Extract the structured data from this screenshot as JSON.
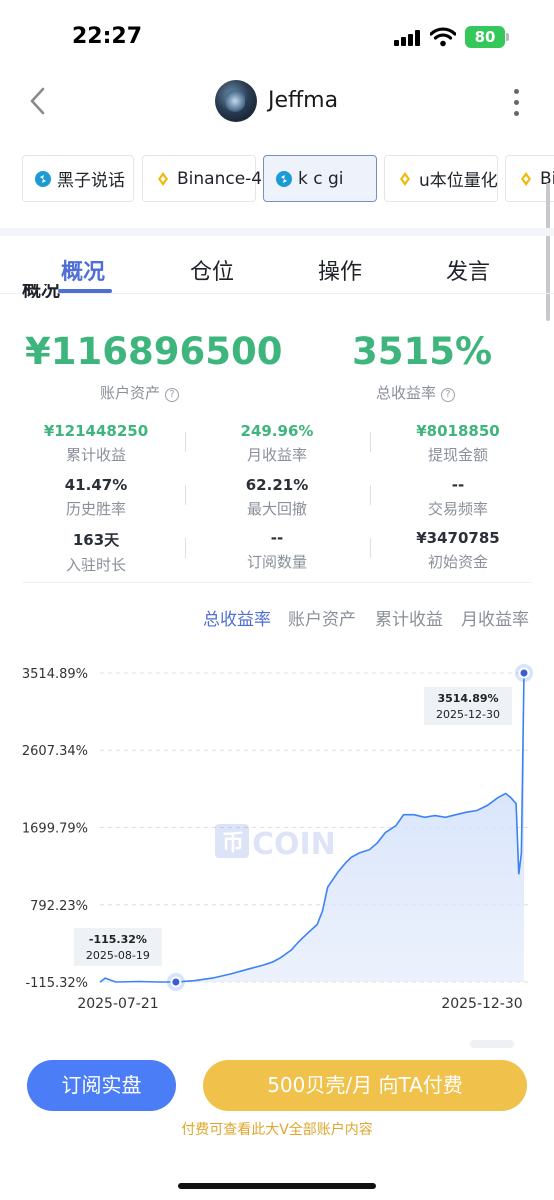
{
  "status_bar": {
    "time": "22:27",
    "battery": "80"
  },
  "header": {
    "username": "Jeffma",
    "back_icon": "chevron-left-icon",
    "more_icon": "more-vertical-icon"
  },
  "accounts": [
    {
      "label": "黑子说话",
      "icon": "exchange-logo-icon",
      "active": false
    },
    {
      "label": "Binance-4",
      "icon": "binance-diamond-icon",
      "active": false
    },
    {
      "label": "k c gi",
      "icon": "exchange-logo-icon",
      "active": true
    },
    {
      "label": "u本位量化",
      "icon": "binance-diamond-icon",
      "active": false
    },
    {
      "label": "Bin",
      "icon": "binance-diamond-icon",
      "active": false
    }
  ],
  "tabs": [
    "概况",
    "仓位",
    "操作",
    "发言"
  ],
  "section_peek": "概况",
  "summary": {
    "assets_value": "¥116896500",
    "assets_label": "账户资产",
    "return_value": "3515%",
    "return_label": "总收益率"
  },
  "stats": [
    {
      "value": "¥121448250",
      "label": "累计收益"
    },
    {
      "value": "249.96%",
      "label": "月收益率"
    },
    {
      "value": "¥8018850",
      "label": "提现金额"
    },
    {
      "value": "41.47%",
      "label": "历史胜率"
    },
    {
      "value": "62.21%",
      "label": "最大回撤"
    },
    {
      "value": "--",
      "label": "交易频率"
    },
    {
      "value": "163天",
      "label": "入驻时长"
    },
    {
      "value": "--",
      "label": "订阅数量"
    },
    {
      "value": "¥3470785",
      "label": "初始资金"
    }
  ],
  "chart_tabs": [
    "总收益率",
    "账户资产",
    "累计收益",
    "月收益率"
  ],
  "chart_watermark": "COIN",
  "chart_data": {
    "type": "area",
    "ylabels": [
      "3514.89%",
      "2607.34%",
      "1699.79%",
      "792.23%",
      "-115.32%"
    ],
    "yticks": [
      3514.89,
      2607.34,
      1699.79,
      792.23,
      -115.32
    ],
    "ylim": [
      -115.32,
      3514.89
    ],
    "xlabels": [
      "2025-07-21",
      "2025-12-30"
    ],
    "x": [
      "2025-07-21",
      "2025-07-23",
      "2025-07-27",
      "2025-08-05",
      "2025-08-12",
      "2025-08-19",
      "2025-08-26",
      "2025-09-02",
      "2025-09-09",
      "2025-09-16",
      "2025-09-21",
      "2025-09-25",
      "2025-09-28",
      "2025-10-02",
      "2025-10-05",
      "2025-10-08",
      "2025-10-12",
      "2025-10-14",
      "2025-10-16",
      "2025-10-20",
      "2025-10-23",
      "2025-10-25",
      "2025-10-28",
      "2025-11-01",
      "2025-11-04",
      "2025-11-07",
      "2025-11-11",
      "2025-11-14",
      "2025-11-18",
      "2025-11-22",
      "2025-11-26",
      "2025-11-30",
      "2025-12-04",
      "2025-12-08",
      "2025-12-12",
      "2025-12-16",
      "2025-12-20",
      "2025-12-23",
      "2025-12-25",
      "2025-12-27",
      "2025-12-28",
      "2025-12-29",
      "2025-12-30"
    ],
    "y": [
      -115,
      -70,
      -115,
      -110,
      -115,
      -115,
      -100,
      -70,
      -20,
      40,
      80,
      120,
      170,
      260,
      360,
      450,
      560,
      720,
      1000,
      1180,
      1290,
      1350,
      1400,
      1440,
      1520,
      1640,
      1720,
      1850,
      1850,
      1820,
      1840,
      1820,
      1850,
      1880,
      1900,
      1960,
      2050,
      2100,
      2050,
      1980,
      1150,
      1400,
      3514.89
    ],
    "highlights": [
      {
        "x": "2025-08-19",
        "y": -115.32,
        "value_label": "-115.32%",
        "date_label": "2025-08-19"
      },
      {
        "x": "2025-12-30",
        "y": 3514.89,
        "value_label": "3514.89%",
        "date_label": "2025-12-30"
      }
    ],
    "line_color": "#3b82f6",
    "grid": true
  },
  "bottom": {
    "subscribe_label": "订阅实盘",
    "pay_label": "500贝壳/月 向TA付费",
    "note": "付费可查看此大V全部账户内容"
  },
  "colors": {
    "accent": "#4f6fd6",
    "positive": "#3eb57d",
    "pay": "#f0c24b",
    "subscribe": "#4a7df6"
  }
}
